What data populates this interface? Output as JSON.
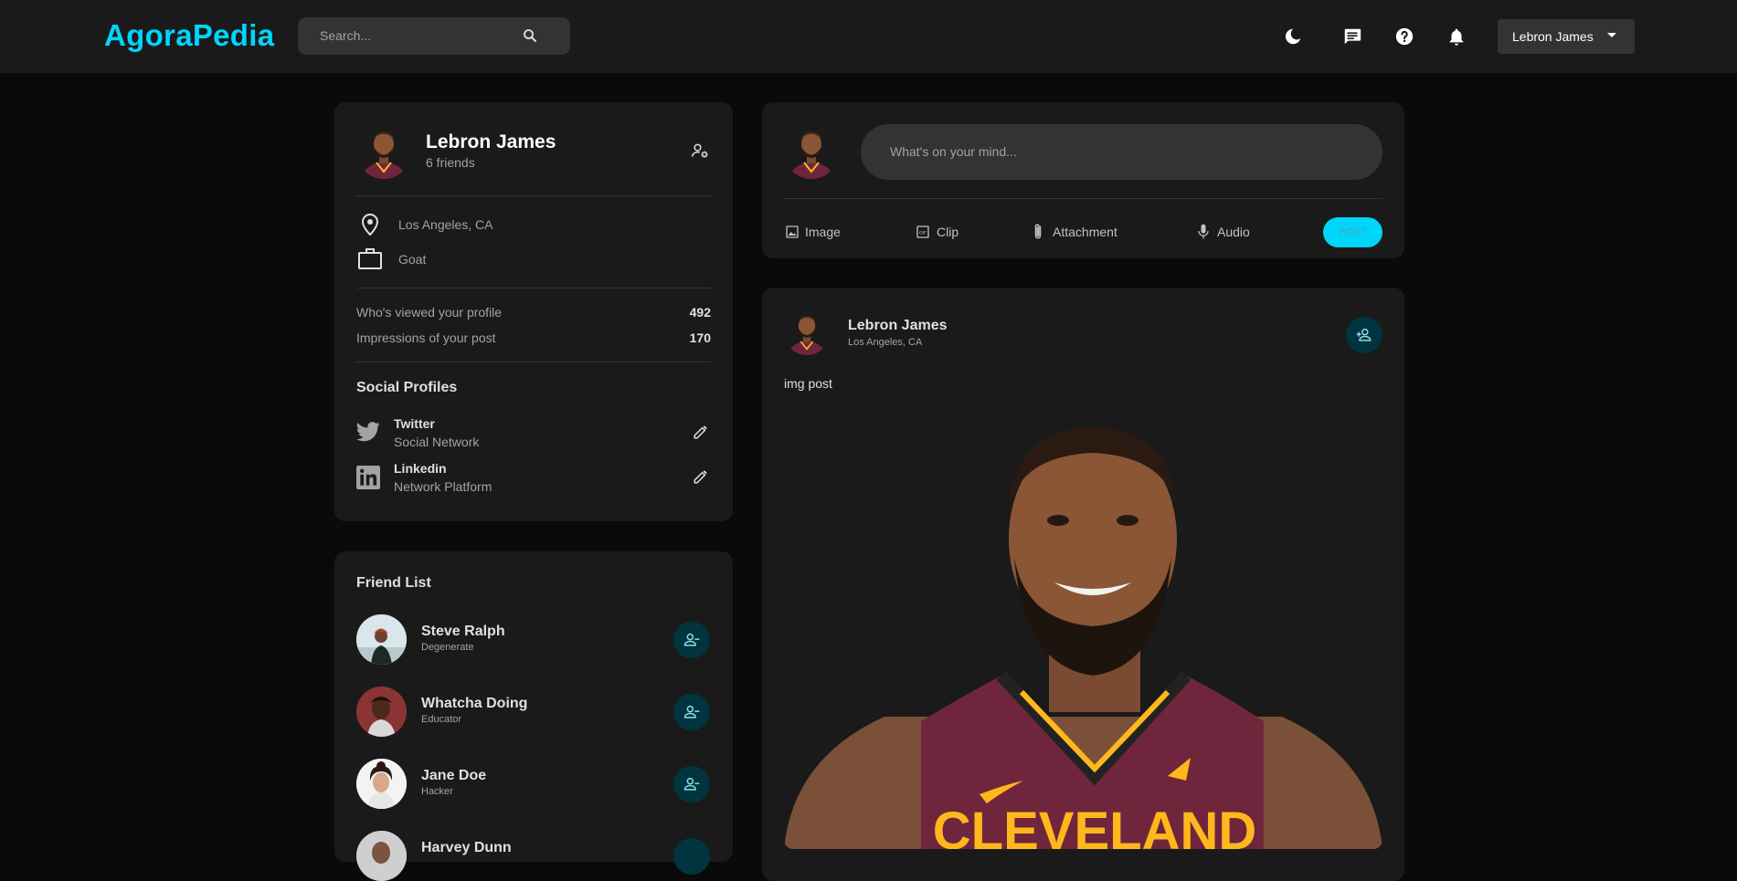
{
  "app": {
    "brand": "AgoraPedia"
  },
  "nav": {
    "search_placeholder": "Search...",
    "user_name": "Lebron James",
    "icons": [
      "moon-icon",
      "message-icon",
      "help-icon",
      "bell-icon",
      "search-icon"
    ]
  },
  "profile": {
    "name": "Lebron James",
    "friends": "6 friends",
    "location": "Los Angeles, CA",
    "occupation": "Goat",
    "viewed_label": "Who's viewed your profile",
    "viewed_value": "492",
    "impressions_label": "Impressions of your post",
    "impressions_value": "170",
    "social_title": "Social Profiles",
    "socials": [
      {
        "name": "Twitter",
        "sub": "Social Network"
      },
      {
        "name": "Linkedin",
        "sub": "Network Platform"
      }
    ]
  },
  "friends": {
    "title": "Friend List",
    "items": [
      {
        "name": "Steve Ralph",
        "role": "Degenerate"
      },
      {
        "name": "Whatcha Doing",
        "role": "Educator"
      },
      {
        "name": "Jane Doe",
        "role": "Hacker"
      },
      {
        "name": "Harvey Dunn",
        "role": ""
      }
    ]
  },
  "composer": {
    "placeholder": "What's on your mind...",
    "image_label": "Image",
    "clip_label": "Clip",
    "attachment_label": "Attachment",
    "audio_label": "Audio",
    "post_label": "POST"
  },
  "post": {
    "author": "Lebron James",
    "location": "Los Angeles, CA",
    "text": "img post",
    "jersey_text": "CLEVELAND"
  },
  "colors": {
    "accent": "#00d5fa",
    "background": "#0a0a0a",
    "card": "#1a1a1a",
    "input": "#333333",
    "jersey": "#6f263d"
  }
}
